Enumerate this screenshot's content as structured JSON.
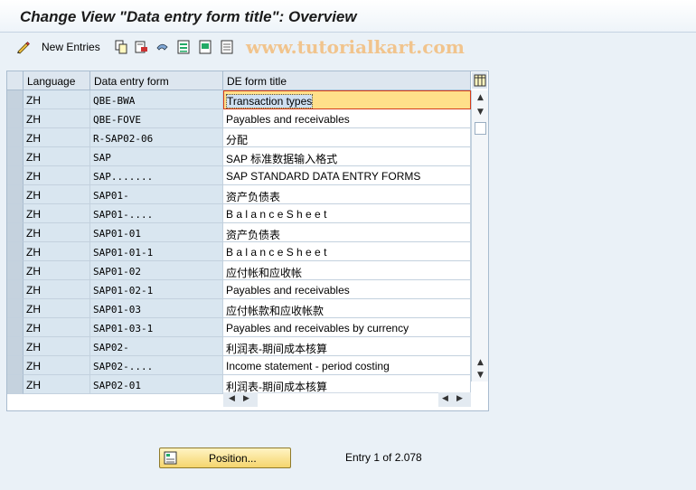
{
  "window": {
    "title": "Change View \"Data entry form title\": Overview"
  },
  "toolbar": {
    "new_entries_label": "New Entries",
    "watermark": "www.tutorialkart.com"
  },
  "table": {
    "columns": [
      "Language",
      "Data entry form",
      "DE form title"
    ],
    "rows": [
      {
        "language": "ZH",
        "form": "QBE-BWA",
        "title": "Transaction types"
      },
      {
        "language": "ZH",
        "form": "QBE-FOVE",
        "title": "Payables and receivables"
      },
      {
        "language": "ZH",
        "form": "R-SAP02-06",
        "title": "分配"
      },
      {
        "language": "ZH",
        "form": "SAP",
        "title": "SAP 标准数据输入格式"
      },
      {
        "language": "ZH",
        "form": "SAP.......",
        "title": "SAP STANDARD DATA ENTRY FORMS"
      },
      {
        "language": "ZH",
        "form": "SAP01-",
        "title": "资产负债表"
      },
      {
        "language": "ZH",
        "form": "SAP01-....",
        "title": "B a l a n c e   S h e e t"
      },
      {
        "language": "ZH",
        "form": "SAP01-01",
        "title": "资产负债表"
      },
      {
        "language": "ZH",
        "form": "SAP01-01-1",
        "title": "B a l a n c e   S h e e t"
      },
      {
        "language": "ZH",
        "form": "SAP01-02",
        "title": "应付帐和应收帐"
      },
      {
        "language": "ZH",
        "form": "SAP01-02-1",
        "title": "Payables and receivables"
      },
      {
        "language": "ZH",
        "form": "SAP01-03",
        "title": "应付帐款和应收帐款"
      },
      {
        "language": "ZH",
        "form": "SAP01-03-1",
        "title": "Payables and receivables by currency"
      },
      {
        "language": "ZH",
        "form": "SAP02-",
        "title": "利润表-期间成本核算"
      },
      {
        "language": "ZH",
        "form": "SAP02-....",
        "title": "Income statement - period costing"
      },
      {
        "language": "ZH",
        "form": "SAP02-01",
        "title": "利润表-期间成本核算"
      }
    ]
  },
  "footer": {
    "position_label": "Position...",
    "entry_text": "Entry 1 of 2.078"
  }
}
